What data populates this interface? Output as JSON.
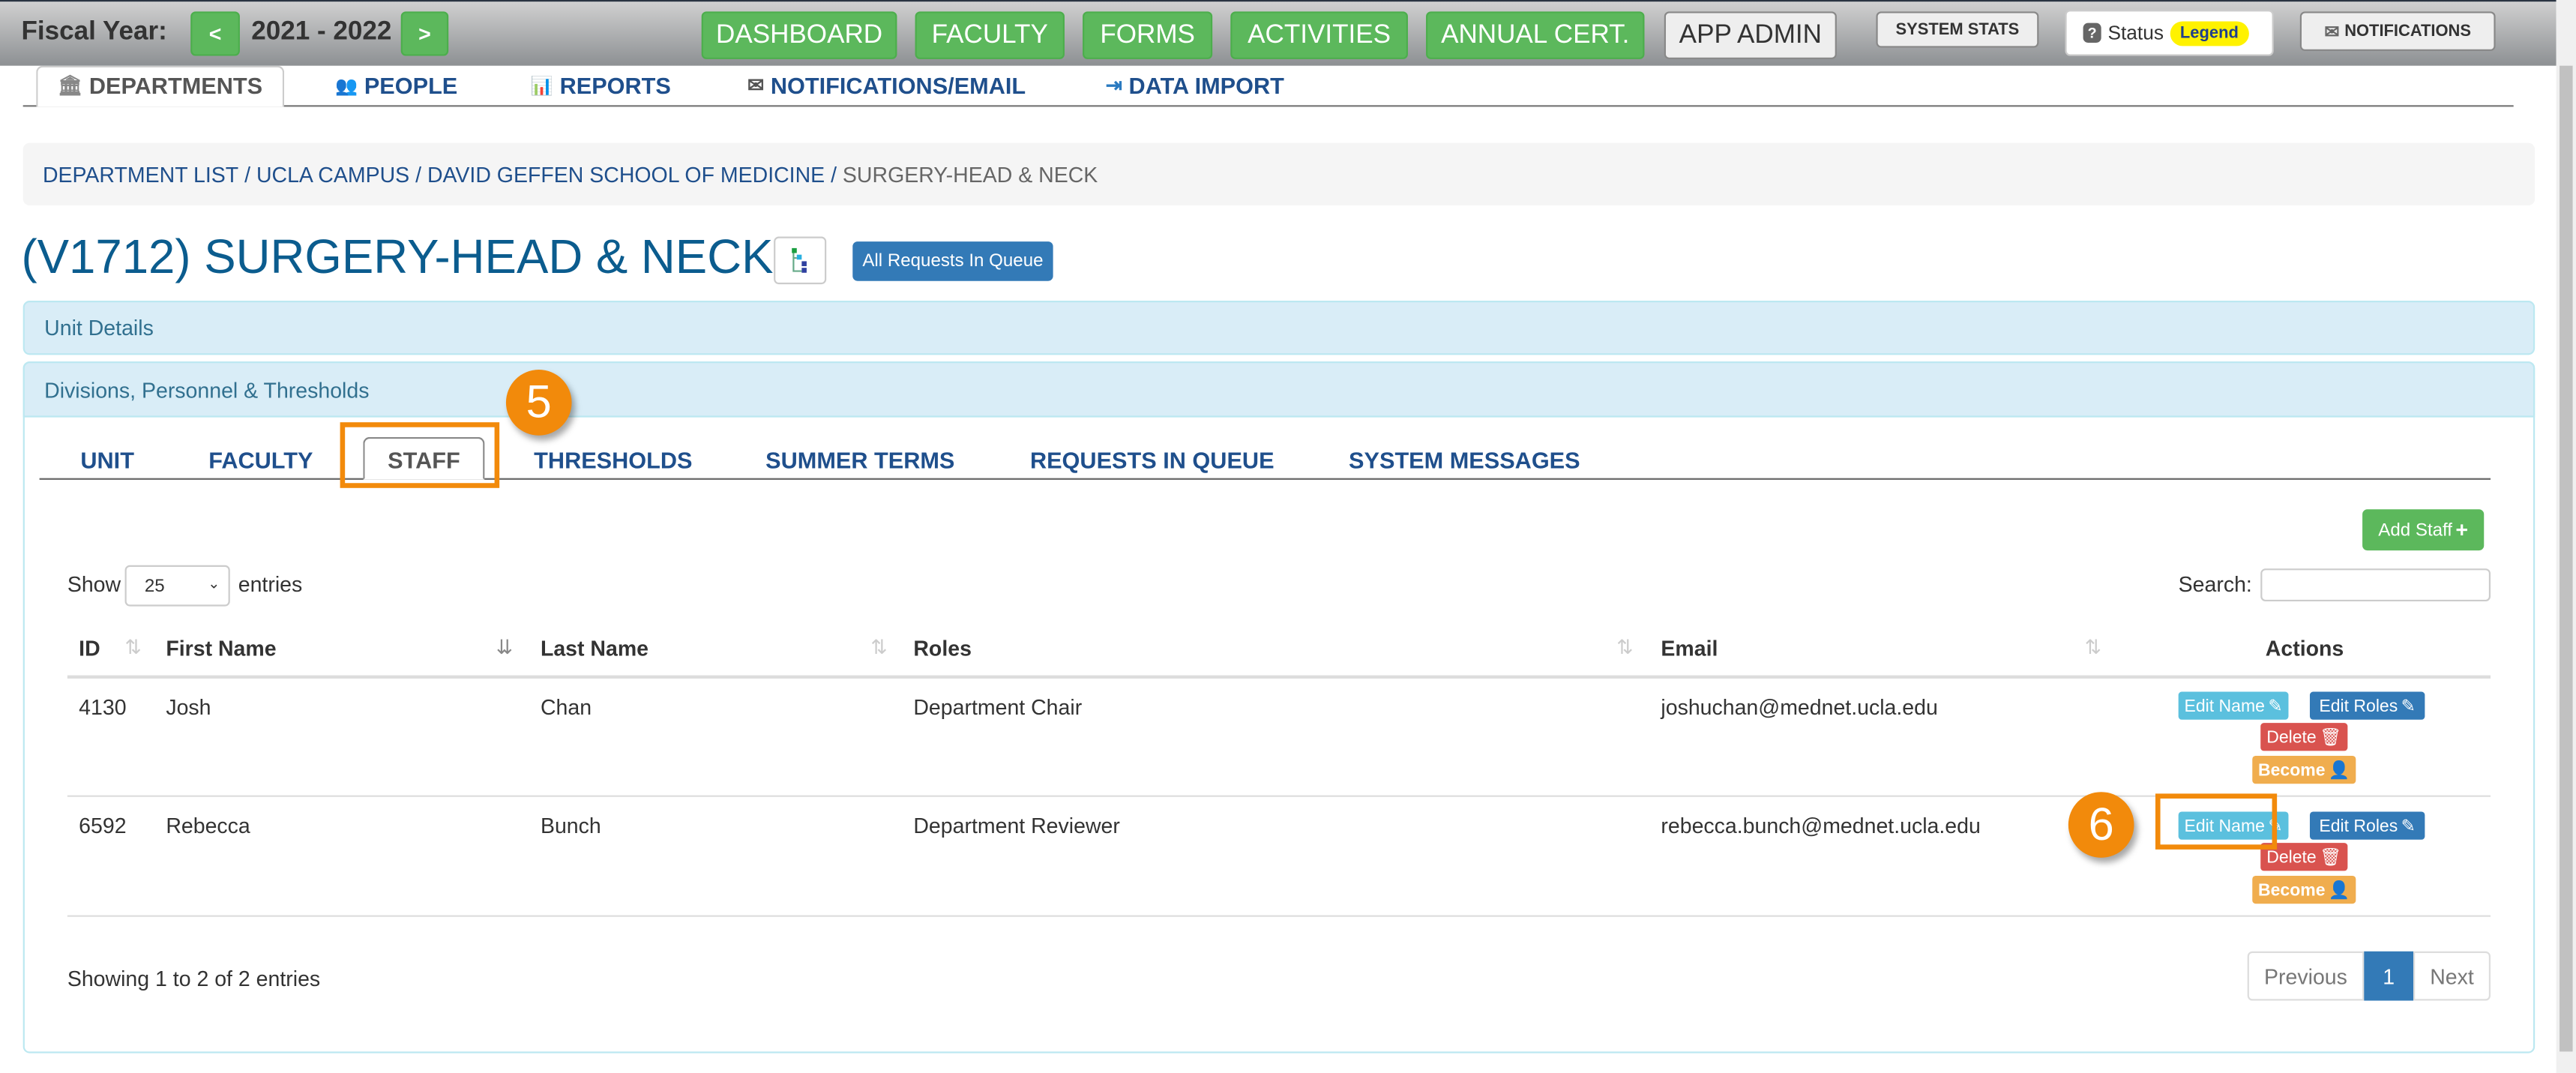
{
  "header": {
    "fiscal_year_label": "Fiscal Year:",
    "fiscal_year": "2021 - 2022",
    "prev": "<",
    "next": ">",
    "nav": [
      "DASHBOARD",
      "FACULTY",
      "FORMS",
      "ACTIVITIES",
      "ANNUAL CERT."
    ],
    "app_admin": "APP ADMIN",
    "system_stats": "SYSTEM STATS",
    "status": "Status",
    "legend": "Legend",
    "notifications": "NOTIFICATIONS"
  },
  "main_tabs": [
    "DEPARTMENTS",
    "PEOPLE",
    "REPORTS",
    "NOTIFICATIONS/EMAIL",
    "DATA IMPORT"
  ],
  "breadcrumb": {
    "items": [
      "DEPARTMENT LIST",
      "UCLA CAMPUS",
      "DAVID GEFFEN SCHOOL OF MEDICINE"
    ],
    "current": "SURGERY-HEAD & NECK",
    "sep": " / "
  },
  "page": {
    "title": "(V1712) SURGERY-HEAD & NECK",
    "all_requests": "All Requests In Queue"
  },
  "panels": {
    "unit_details": "Unit Details",
    "divisions": "Divisions, Personnel & Thresholds"
  },
  "sub_tabs": [
    "UNIT",
    "FACULTY",
    "STAFF",
    "THRESHOLDS",
    "SUMMER TERMS",
    "REQUESTS IN QUEUE",
    "SYSTEM MESSAGES"
  ],
  "active_sub_tab": "STAFF",
  "table": {
    "add_staff": "Add Staff",
    "show": "Show",
    "entries": "entries",
    "page_length": "25",
    "search_label": "Search:",
    "search_value": "",
    "columns": [
      "ID",
      "First Name",
      "Last Name",
      "Roles",
      "Email",
      "Actions"
    ],
    "rows": [
      {
        "id": "4130",
        "first": "Josh",
        "last": "Chan",
        "role": "Department Chair",
        "email": "joshuchan@mednet.ucla.edu"
      },
      {
        "id": "6592",
        "first": "Rebecca",
        "last": "Bunch",
        "role": "Department Reviewer",
        "email": "rebecca.bunch@mednet.ucla.edu"
      }
    ],
    "actions": {
      "edit_name": "Edit Name",
      "edit_roles": "Edit Roles",
      "delete": "Delete",
      "become": "Become"
    },
    "info": "Showing 1 to 2 of 2 entries",
    "pagination": {
      "previous": "Previous",
      "current": "1",
      "next": "Next"
    }
  },
  "annotations": [
    "5",
    "6"
  ],
  "colors": {
    "green": "#5cb85c",
    "accent_orange": "#f28a0b",
    "title_blue": "#0b5c8e",
    "primary": "#337ab7",
    "info": "#5bc0de",
    "danger": "#d9534f",
    "warning": "#f0ad4e"
  }
}
